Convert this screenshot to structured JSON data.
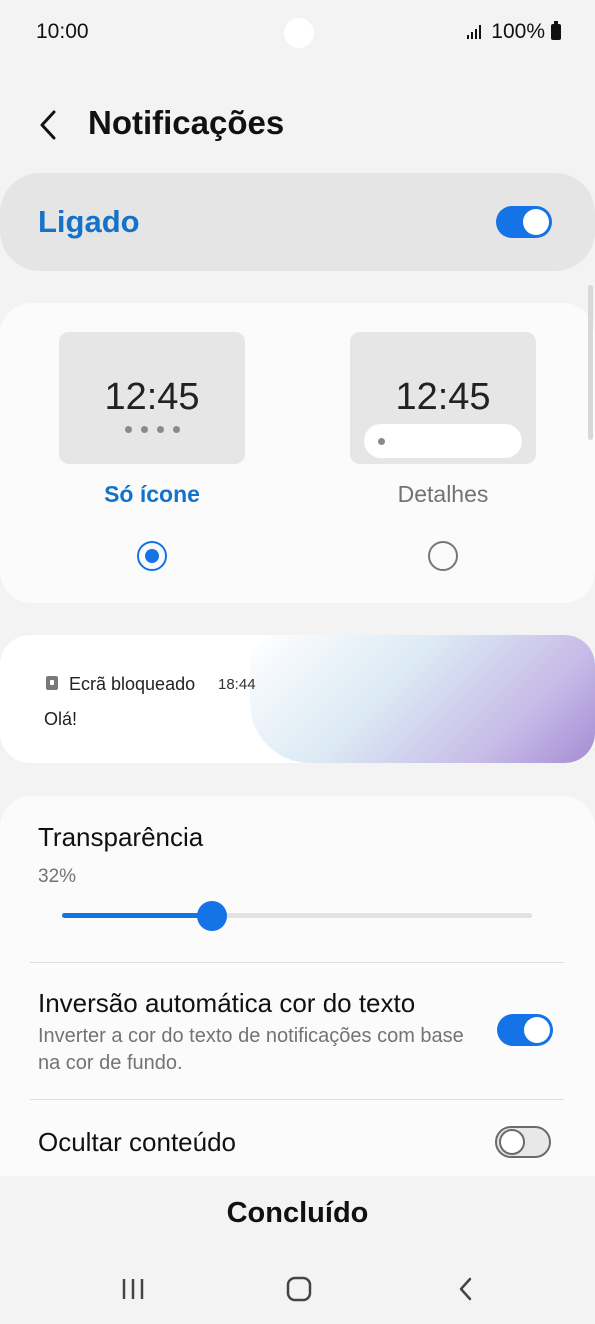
{
  "status_bar": {
    "time": "10:00",
    "battery": "100%",
    "icons": [
      "signal-icon",
      "battery-icon"
    ]
  },
  "header": {
    "title": "Notificações",
    "back_icon": "back-arrow-icon"
  },
  "master_toggle": {
    "label": "Ligado",
    "on": true
  },
  "style_options": [
    {
      "preview_time": "12:45",
      "label": "Só ícone",
      "selected": true,
      "accent": "#1473c9"
    },
    {
      "preview_time": "12:45",
      "label": "Detalhes",
      "selected": false,
      "text_color": "#737373"
    }
  ],
  "notification_preview": {
    "app": "Ecrã bloqueado",
    "time": "18:44",
    "message": "Olá!",
    "icon": "lock-icon"
  },
  "settings": {
    "transparency": {
      "title": "Transparência",
      "value_label": "32%",
      "value": 0.32
    },
    "auto_invert": {
      "title": "Inversão automática cor do texto",
      "subtitle": "Inverter a cor do texto de notificações com base na cor de fundo.",
      "on": true
    },
    "hide_content": {
      "title": "Ocultar conteúdo",
      "on": false
    }
  },
  "done_label": "Concluído",
  "nav_bar": [
    "recents-icon",
    "home-icon",
    "back-icon"
  ],
  "colors": {
    "accent": "#1473e6",
    "label_blue": "#1473c9"
  }
}
